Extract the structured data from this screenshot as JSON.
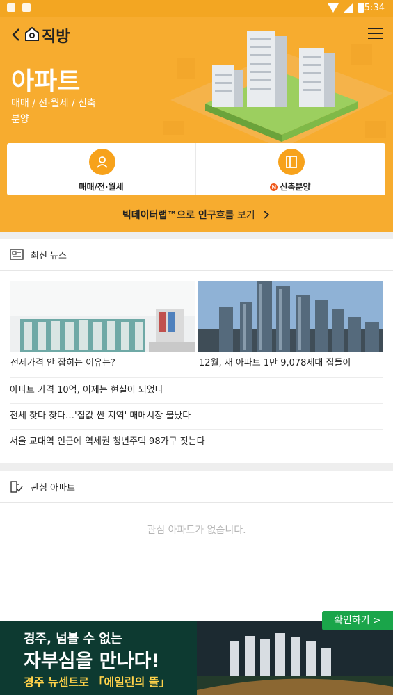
{
  "status_bar": {
    "time": "5:34"
  },
  "header": {
    "brand": "직방"
  },
  "hero": {
    "title": "아파트",
    "subtitle": "매매 / 전·월세 / 신축분양"
  },
  "cards": {
    "left": {
      "label": "매매/전·월세",
      "icon": "person-pin-icon"
    },
    "right": {
      "label": "신축분양",
      "badge": "N",
      "icon": "book-icon"
    }
  },
  "bigdata": {
    "prefix": "빅데이터랩™으로 ",
    "highlight": "인구흐름",
    "suffix": " 보기"
  },
  "news": {
    "title": "최신 뉴스",
    "featured": [
      {
        "caption": "전세가격 안 잡히는 이유는?"
      },
      {
        "caption": "12월, 새 아파트 1만 9,078세대 집들이"
      }
    ],
    "items": [
      "아파트 가격 10억, 이제는 현실이 되었다",
      "전세 찾다 찾다…'집값 싼 지역' 매매시장 불났다",
      "서울 교대역 인근에 역세권 청년주택 98가구 짓는다"
    ]
  },
  "favorites": {
    "title": "관심 아파트",
    "empty_message": "관심 아파트가 없습니다."
  },
  "ad": {
    "line1": "경주, 넘볼 수 없는",
    "line2": "자부심을 만나다!",
    "line3": "경주 뉴센트로 「에일린의 뜰」",
    "confirm_label": "확인하기 >"
  },
  "colors": {
    "brand_orange": "#f7ac2f",
    "accent_orange": "#f7a21b",
    "confirm_green": "#1aa54a"
  }
}
